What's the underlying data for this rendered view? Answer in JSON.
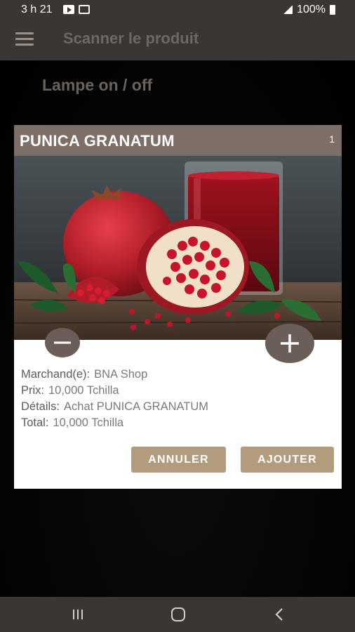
{
  "status_bar": {
    "time": "3 h 21",
    "battery": "100%"
  },
  "app_bar": {
    "title": "Scanner le produit"
  },
  "background": {
    "lamp_toggle": "Lampe on / off"
  },
  "dialog": {
    "product_name": "PUNICA GRANATUM",
    "quantity": "1",
    "info": {
      "merchant_label": "Marchand(e):",
      "merchant_value": "BNA Shop",
      "price_label": "Prix:",
      "price_value": "10,000 Tchilla",
      "details_label": "Détails:",
      "details_value": "Achat PUNICA GRANATUM",
      "total_label": "Total:",
      "total_value": "10,000 Tchilla"
    },
    "cancel_label": "ANNULER",
    "add_label": "AJOUTER"
  },
  "colors": {
    "header": "#7d6f68",
    "button": "#b29c7d",
    "bar": "#3a3633",
    "round_button": "#6b5d57"
  }
}
